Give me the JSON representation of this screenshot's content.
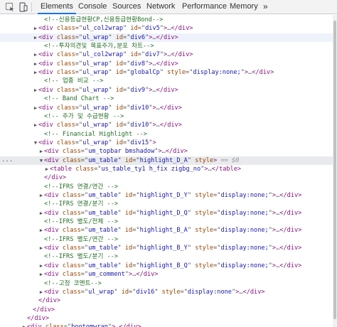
{
  "toolbar": {
    "icons": [
      "inspect-element-icon",
      "device-toolbar-icon"
    ],
    "tabs": [
      "Elements",
      "Console",
      "Sources",
      "Network",
      "Performance",
      "Memory"
    ],
    "active_tab": "Elements",
    "more": "»"
  },
  "selected_row_marker": "...",
  "rows": [
    {
      "indent": 4,
      "tw": "",
      "seg": [
        [
          "cm",
          "<!--신용등급현황CP,신용등급현황Bond-->"
        ]
      ]
    },
    {
      "indent": 3,
      "tw": "▶",
      "seg": [
        [
          "tag",
          "<div "
        ],
        [
          "an",
          "class"
        ],
        [
          "eq",
          "=\""
        ],
        [
          "av",
          "ul_col2wrap"
        ],
        [
          "eq",
          "\" "
        ],
        [
          "an",
          "id"
        ],
        [
          "eq",
          "=\""
        ],
        [
          "av",
          "div5"
        ],
        [
          "eq",
          "\""
        ],
        [
          "tag",
          ">"
        ],
        [
          "ell",
          "…"
        ],
        [
          "tag",
          "</div>"
        ]
      ]
    },
    {
      "indent": 3,
      "tw": "▶",
      "hov": true,
      "seg": [
        [
          "tag",
          "<div "
        ],
        [
          "an",
          "class"
        ],
        [
          "eq",
          "=\""
        ],
        [
          "av",
          "ul_wrap"
        ],
        [
          "eq",
          "\" "
        ],
        [
          "an",
          "id"
        ],
        [
          "eq",
          "=\""
        ],
        [
          "av",
          "div6"
        ],
        [
          "eq",
          "\""
        ],
        [
          "tag",
          ">"
        ],
        [
          "ell",
          "…"
        ],
        [
          "tag",
          "</div>"
        ]
      ]
    },
    {
      "indent": 4,
      "tw": "",
      "seg": [
        [
          "cm",
          "<!--투자의견및 목표주가,분포 차트-->"
        ]
      ]
    },
    {
      "indent": 3,
      "tw": "▶",
      "seg": [
        [
          "tag",
          "<div "
        ],
        [
          "an",
          "class"
        ],
        [
          "eq",
          "=\""
        ],
        [
          "av",
          "ul_col2wrap"
        ],
        [
          "eq",
          "\" "
        ],
        [
          "an",
          "id"
        ],
        [
          "eq",
          "=\""
        ],
        [
          "av",
          "div7"
        ],
        [
          "eq",
          "\""
        ],
        [
          "tag",
          ">"
        ],
        [
          "ell",
          "…"
        ],
        [
          "tag",
          "</div>"
        ]
      ]
    },
    {
      "indent": 3,
      "tw": "▶",
      "seg": [
        [
          "tag",
          "<div "
        ],
        [
          "an",
          "class"
        ],
        [
          "eq",
          "=\""
        ],
        [
          "av",
          "ul_wrap"
        ],
        [
          "eq",
          "\" "
        ],
        [
          "an",
          "id"
        ],
        [
          "eq",
          "=\""
        ],
        [
          "av",
          "div8"
        ],
        [
          "eq",
          "\""
        ],
        [
          "tag",
          ">"
        ],
        [
          "ell",
          "…"
        ],
        [
          "tag",
          "</div>"
        ]
      ]
    },
    {
      "indent": 3,
      "tw": "▶",
      "seg": [
        [
          "tag",
          "<div "
        ],
        [
          "an",
          "class"
        ],
        [
          "eq",
          "=\""
        ],
        [
          "av",
          "ul_wrap"
        ],
        [
          "eq",
          "\" "
        ],
        [
          "an",
          "id"
        ],
        [
          "eq",
          "=\""
        ],
        [
          "av",
          "globalCp"
        ],
        [
          "eq",
          "\" "
        ],
        [
          "an",
          "style"
        ],
        [
          "eq",
          "=\""
        ],
        [
          "av",
          "display:none;"
        ],
        [
          "eq",
          "\""
        ],
        [
          "tag",
          ">"
        ],
        [
          "ell",
          "…"
        ],
        [
          "tag",
          "</div>"
        ]
      ]
    },
    {
      "indent": 4,
      "tw": "",
      "seg": [
        [
          "cm",
          "<!-- 업종 비교 -->"
        ]
      ]
    },
    {
      "indent": 3,
      "tw": "▶",
      "seg": [
        [
          "tag",
          "<div "
        ],
        [
          "an",
          "class"
        ],
        [
          "eq",
          "=\""
        ],
        [
          "av",
          "ul_wrap"
        ],
        [
          "eq",
          "\" "
        ],
        [
          "an",
          "id"
        ],
        [
          "eq",
          "=\""
        ],
        [
          "av",
          "div9"
        ],
        [
          "eq",
          "\""
        ],
        [
          "tag",
          ">"
        ],
        [
          "ell",
          "…"
        ],
        [
          "tag",
          "</div>"
        ]
      ]
    },
    {
      "indent": 4,
      "tw": "",
      "seg": [
        [
          "cm",
          "<!-- Band Chart -->"
        ]
      ]
    },
    {
      "indent": 3,
      "tw": "▶",
      "seg": [
        [
          "tag",
          "<div "
        ],
        [
          "an",
          "class"
        ],
        [
          "eq",
          "=\""
        ],
        [
          "av",
          "ul_wrap"
        ],
        [
          "eq",
          "\" "
        ],
        [
          "an",
          "id"
        ],
        [
          "eq",
          "=\""
        ],
        [
          "av",
          "div10"
        ],
        [
          "eq",
          "\""
        ],
        [
          "tag",
          ">"
        ],
        [
          "ell",
          "…"
        ],
        [
          "tag",
          "</div>"
        ]
      ]
    },
    {
      "indent": 4,
      "tw": "",
      "seg": [
        [
          "cm",
          "<!-- 주가 및 수급현황 -->"
        ]
      ]
    },
    {
      "indent": 3,
      "tw": "▶",
      "seg": [
        [
          "tag",
          "<div "
        ],
        [
          "an",
          "class"
        ],
        [
          "eq",
          "=\""
        ],
        [
          "av",
          "ul_wrap"
        ],
        [
          "eq",
          "\" "
        ],
        [
          "an",
          "id"
        ],
        [
          "eq",
          "=\""
        ],
        [
          "av",
          "div10"
        ],
        [
          "eq",
          "\""
        ],
        [
          "tag",
          ">"
        ],
        [
          "ell",
          "…"
        ],
        [
          "tag",
          "</div>"
        ]
      ]
    },
    {
      "indent": 4,
      "tw": "",
      "seg": [
        [
          "cm",
          "<!-- Financial Highlight -->"
        ]
      ]
    },
    {
      "indent": 3,
      "tw": "▼",
      "seg": [
        [
          "tag",
          "<div "
        ],
        [
          "an",
          "class"
        ],
        [
          "eq",
          "=\""
        ],
        [
          "av",
          "ul_wrap"
        ],
        [
          "eq",
          "\" "
        ],
        [
          "an",
          "id"
        ],
        [
          "eq",
          "=\""
        ],
        [
          "av",
          "div15"
        ],
        [
          "eq",
          "\""
        ],
        [
          "tag",
          ">"
        ]
      ]
    },
    {
      "indent": 4,
      "tw": "▶",
      "seg": [
        [
          "tag",
          "<div "
        ],
        [
          "an",
          "class"
        ],
        [
          "eq",
          "=\""
        ],
        [
          "av",
          "um_topbar bmshadow"
        ],
        [
          "eq",
          "\""
        ],
        [
          "tag",
          ">"
        ],
        [
          "ell",
          "…"
        ],
        [
          "tag",
          "</div>"
        ]
      ]
    },
    {
      "indent": 4,
      "tw": "▼",
      "sel": true,
      "seg": [
        [
          "tag",
          "<div "
        ],
        [
          "an",
          "class"
        ],
        [
          "eq",
          "=\""
        ],
        [
          "av",
          "um_table"
        ],
        [
          "eq",
          "\" "
        ],
        [
          "an",
          "id"
        ],
        [
          "eq",
          "=\""
        ],
        [
          "av",
          "highlight_D_A"
        ],
        [
          "eq",
          "\" "
        ],
        [
          "an",
          "style"
        ],
        [
          "tag",
          ">"
        ],
        [
          "sv",
          " == $0"
        ]
      ]
    },
    {
      "indent": 5,
      "tw": "▶",
      "seg": [
        [
          "tag",
          "<table "
        ],
        [
          "an",
          "class"
        ],
        [
          "eq",
          "=\""
        ],
        [
          "av",
          "us_table_ty1 h_fix zigbg_no"
        ],
        [
          "eq",
          "\""
        ],
        [
          "tag",
          ">"
        ],
        [
          "ell",
          "…"
        ],
        [
          "tag",
          "</table>"
        ]
      ]
    },
    {
      "indent": 4,
      "tw": "",
      "seg": [
        [
          "tag",
          "</div>"
        ]
      ]
    },
    {
      "indent": 4,
      "tw": "",
      "seg": [
        [
          "cm",
          "<!--IFRS 연결/연간 -->"
        ]
      ]
    },
    {
      "indent": 4,
      "tw": "▶",
      "seg": [
        [
          "tag",
          "<div "
        ],
        [
          "an",
          "class"
        ],
        [
          "eq",
          "=\""
        ],
        [
          "av",
          "um_table"
        ],
        [
          "eq",
          "\" "
        ],
        [
          "an",
          "id"
        ],
        [
          "eq",
          "=\""
        ],
        [
          "av",
          "highlight_D_Y"
        ],
        [
          "eq",
          "\" "
        ],
        [
          "an",
          "style"
        ],
        [
          "eq",
          "=\""
        ],
        [
          "av",
          "display:none;"
        ],
        [
          "eq",
          "\""
        ],
        [
          "tag",
          ">"
        ],
        [
          "ell",
          "…"
        ],
        [
          "tag",
          "</div>"
        ]
      ]
    },
    {
      "indent": 4,
      "tw": "",
      "seg": [
        [
          "cm",
          "<!--IFRS 연결/분기 -->"
        ]
      ]
    },
    {
      "indent": 4,
      "tw": "▶",
      "seg": [
        [
          "tag",
          "<div "
        ],
        [
          "an",
          "class"
        ],
        [
          "eq",
          "=\""
        ],
        [
          "av",
          "um_table"
        ],
        [
          "eq",
          "\" "
        ],
        [
          "an",
          "id"
        ],
        [
          "eq",
          "=\""
        ],
        [
          "av",
          "highlight_D_Q"
        ],
        [
          "eq",
          "\" "
        ],
        [
          "an",
          "style"
        ],
        [
          "eq",
          "=\""
        ],
        [
          "av",
          "display:none;"
        ],
        [
          "eq",
          "\""
        ],
        [
          "tag",
          ">"
        ],
        [
          "ell",
          "…"
        ],
        [
          "tag",
          "</div>"
        ]
      ]
    },
    {
      "indent": 4,
      "tw": "",
      "seg": [
        [
          "cm",
          "<!--IFRS 별도/전체 -->"
        ]
      ]
    },
    {
      "indent": 4,
      "tw": "▶",
      "seg": [
        [
          "tag",
          "<div "
        ],
        [
          "an",
          "class"
        ],
        [
          "eq",
          "=\""
        ],
        [
          "av",
          "um_table"
        ],
        [
          "eq",
          "\" "
        ],
        [
          "an",
          "id"
        ],
        [
          "eq",
          "=\""
        ],
        [
          "av",
          "highlight_B_A"
        ],
        [
          "eq",
          "\" "
        ],
        [
          "an",
          "style"
        ],
        [
          "eq",
          "=\""
        ],
        [
          "av",
          "display:none;"
        ],
        [
          "eq",
          "\""
        ],
        [
          "tag",
          ">"
        ],
        [
          "ell",
          "…"
        ],
        [
          "tag",
          "</div>"
        ]
      ]
    },
    {
      "indent": 4,
      "tw": "",
      "seg": [
        [
          "cm",
          "<!--IFRS 별도/연간 -->"
        ]
      ]
    },
    {
      "indent": 4,
      "tw": "▶",
      "seg": [
        [
          "tag",
          "<div "
        ],
        [
          "an",
          "class"
        ],
        [
          "eq",
          "=\""
        ],
        [
          "av",
          "um_table"
        ],
        [
          "eq",
          "\" "
        ],
        [
          "an",
          "id"
        ],
        [
          "eq",
          "=\""
        ],
        [
          "av",
          "highlight_B_Y"
        ],
        [
          "eq",
          "\" "
        ],
        [
          "an",
          "style"
        ],
        [
          "eq",
          "=\""
        ],
        [
          "av",
          "display:none;"
        ],
        [
          "eq",
          "\""
        ],
        [
          "tag",
          ">"
        ],
        [
          "ell",
          "…"
        ],
        [
          "tag",
          "</div>"
        ]
      ]
    },
    {
      "indent": 4,
      "tw": "",
      "seg": [
        [
          "cm",
          "<!--IFRS 별도/분기 -->"
        ]
      ]
    },
    {
      "indent": 4,
      "tw": "▶",
      "seg": [
        [
          "tag",
          "<div "
        ],
        [
          "an",
          "class"
        ],
        [
          "eq",
          "=\""
        ],
        [
          "av",
          "um_table"
        ],
        [
          "eq",
          "\" "
        ],
        [
          "an",
          "id"
        ],
        [
          "eq",
          "=\""
        ],
        [
          "av",
          "highlight_B_Q"
        ],
        [
          "eq",
          "\" "
        ],
        [
          "an",
          "style"
        ],
        [
          "eq",
          "=\""
        ],
        [
          "av",
          "display:none;"
        ],
        [
          "eq",
          "\""
        ],
        [
          "tag",
          ">"
        ],
        [
          "ell",
          "…"
        ],
        [
          "tag",
          "</div>"
        ]
      ]
    },
    {
      "indent": 4,
      "tw": "▶",
      "seg": [
        [
          "tag",
          "<div "
        ],
        [
          "an",
          "class"
        ],
        [
          "eq",
          "=\""
        ],
        [
          "av",
          "um_comment"
        ],
        [
          "eq",
          "\""
        ],
        [
          "tag",
          ">"
        ],
        [
          "ell",
          "…"
        ],
        [
          "tag",
          "</div>"
        ]
      ]
    },
    {
      "indent": 4,
      "tw": "",
      "seg": [
        [
          "cm",
          "<!--고정 코멘트-->"
        ]
      ]
    },
    {
      "indent": 4,
      "tw": "▶",
      "seg": [
        [
          "tag",
          "<div "
        ],
        [
          "an",
          "class"
        ],
        [
          "eq",
          "=\""
        ],
        [
          "av",
          "ul_wrap"
        ],
        [
          "eq",
          "\" "
        ],
        [
          "an",
          "id"
        ],
        [
          "eq",
          "=\""
        ],
        [
          "av",
          "div16"
        ],
        [
          "eq",
          "\" "
        ],
        [
          "an",
          "style"
        ],
        [
          "eq",
          "=\""
        ],
        [
          "av",
          "display:none"
        ],
        [
          "eq",
          "\""
        ],
        [
          "tag",
          ">"
        ],
        [
          "ell",
          "…"
        ],
        [
          "tag",
          "</div>"
        ]
      ]
    },
    {
      "indent": 3,
      "tw": "",
      "seg": [
        [
          "tag",
          "</div>"
        ]
      ]
    },
    {
      "indent": 2,
      "tw": "",
      "seg": [
        [
          "tag",
          "</div>"
        ]
      ]
    },
    {
      "indent": 1,
      "tw": "",
      "seg": [
        [
          "tag",
          "</div>"
        ]
      ]
    },
    {
      "indent": 1,
      "tw": "▶",
      "seg": [
        [
          "tag",
          "<div "
        ],
        [
          "an",
          "class"
        ],
        [
          "eq",
          "=\""
        ],
        [
          "av",
          "bootomwrap"
        ],
        [
          "eq",
          "\""
        ],
        [
          "tag",
          ">"
        ],
        [
          "ell",
          "…"
        ],
        [
          "tag",
          "</div>"
        ]
      ]
    }
  ]
}
